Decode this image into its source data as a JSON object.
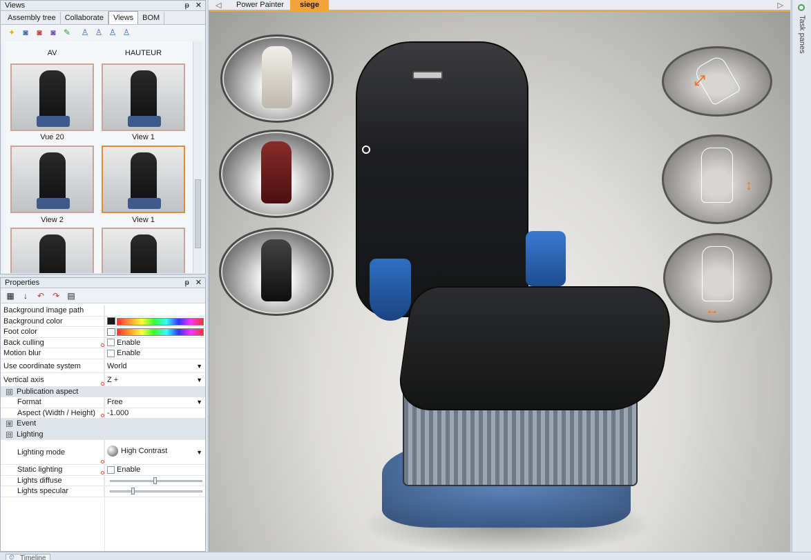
{
  "views_panel": {
    "title": "Views",
    "pin": "ᵽ",
    "close": "✕",
    "tabs": [
      "Assembly tree",
      "Collaborate",
      "Views",
      "BOM"
    ],
    "active_tab": "Views",
    "thumbnails": [
      {
        "label": "AV"
      },
      {
        "label": "HAUTEUR"
      },
      {
        "label": "Vue 20"
      },
      {
        "label": "View 1"
      },
      {
        "label": "View 2"
      },
      {
        "label": "View 1"
      }
    ]
  },
  "properties_panel": {
    "title": "Properties",
    "pin": "ᵽ",
    "close": "✕",
    "rows": {
      "bg_image_path": "Background image path",
      "bg_color": "Background color",
      "foot_color": "Foot color",
      "back_culling": "Back culling",
      "back_culling_val": "Enable",
      "motion_blur": "Motion blur",
      "motion_blur_val": "Enable",
      "coord_system": "Use coordinate system",
      "coord_system_val": "World",
      "vertical_axis": "Vertical axis",
      "vertical_axis_val": "Z +",
      "pub_aspect": "Publication aspect",
      "format": "Format",
      "format_val": "Free",
      "aspect": "Aspect (Width / Height)",
      "aspect_val": "-1.000",
      "event": "Event",
      "lighting": "Lighting",
      "lighting_mode": "Lighting mode",
      "lighting_mode_val": "High Contrast",
      "static_lighting": "Static lighting",
      "static_lighting_val": "Enable",
      "lights_diffuse": "Lights diffuse",
      "lights_specular": "Lights specular"
    },
    "toggles": {
      "collapse": "⊟",
      "expand": "⊞"
    },
    "lights_diffuse_level": 0.47,
    "lights_specular_level": 0.23
  },
  "document": {
    "tabs": [
      "Power Painter",
      "siege"
    ],
    "active_tab": "siege"
  },
  "taskpanes": {
    "label": "Task panes"
  },
  "bottom": {
    "timeline": "Timeline"
  },
  "colors": {
    "accent": "#f2a33a",
    "seat_blue": "#2f6fc4",
    "arrow_orange": "#e8782a"
  }
}
